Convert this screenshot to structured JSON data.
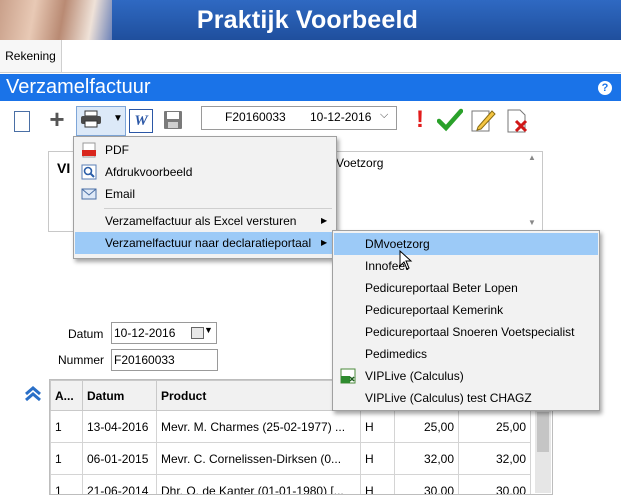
{
  "app": {
    "banner_title": "Praktijk Voorbeeld",
    "tab": "Rekening",
    "page_title": "Verzamelfactuur",
    "help": "?"
  },
  "toolbar": {
    "invoice_number": "F20160033",
    "invoice_date": "10-12-2016",
    "word_label": "W",
    "exclaim": "!"
  },
  "info": {
    "left_text": "VI",
    "right_text": "Voetzorg"
  },
  "form": {
    "datum_label": "Datum",
    "datum_value": "10-12-2016",
    "nummer_label": "Nummer",
    "nummer_value": "F20160033"
  },
  "grid": {
    "headers": [
      "A...",
      "Datum",
      "Product",
      "",
      "",
      ""
    ],
    "rows": [
      [
        "1",
        "13-04-2016",
        "Mevr. M. Charmes (25-02-1977) ...",
        "H",
        "25,00",
        "25,00"
      ],
      [
        "1",
        "06-01-2015",
        "Mevr. C. Cornelissen-Dirksen (0...",
        "H",
        "32,00",
        "32,00"
      ],
      [
        "1",
        "21-06-2014",
        "Dhr. O. de Kanter (01-01-1980) [...",
        "H",
        "30,00",
        "30,00"
      ]
    ]
  },
  "menu": {
    "items": [
      {
        "label": "PDF",
        "icon": "pdf-icon"
      },
      {
        "label": "Afdrukvoorbeeld",
        "icon": "magnifier-icon"
      },
      {
        "label": "Email",
        "icon": "envelope-icon"
      },
      {
        "label": "Verzamelfactuur als Excel versturen",
        "icon": ""
      },
      {
        "label": "Verzamelfactuur naar declaratieportaal",
        "icon": ""
      }
    ]
  },
  "submenu": {
    "items": [
      {
        "label": "DMvoetzorg"
      },
      {
        "label": "Innofeet"
      },
      {
        "label": "Pedicureportaal Beter Lopen"
      },
      {
        "label": "Pedicureportaal Kemerink"
      },
      {
        "label": "Pedicureportaal Snoeren Voetspecialist"
      },
      {
        "label": "Pedimedics"
      },
      {
        "label": "VIPLive (Calculus)"
      },
      {
        "label": "VIPLive (Calculus) test CHAGZ"
      }
    ]
  },
  "colors": {
    "title_bar": "#1a73e8",
    "menu_highlight": "#9ccaf7",
    "banner": "#2f69c2"
  }
}
